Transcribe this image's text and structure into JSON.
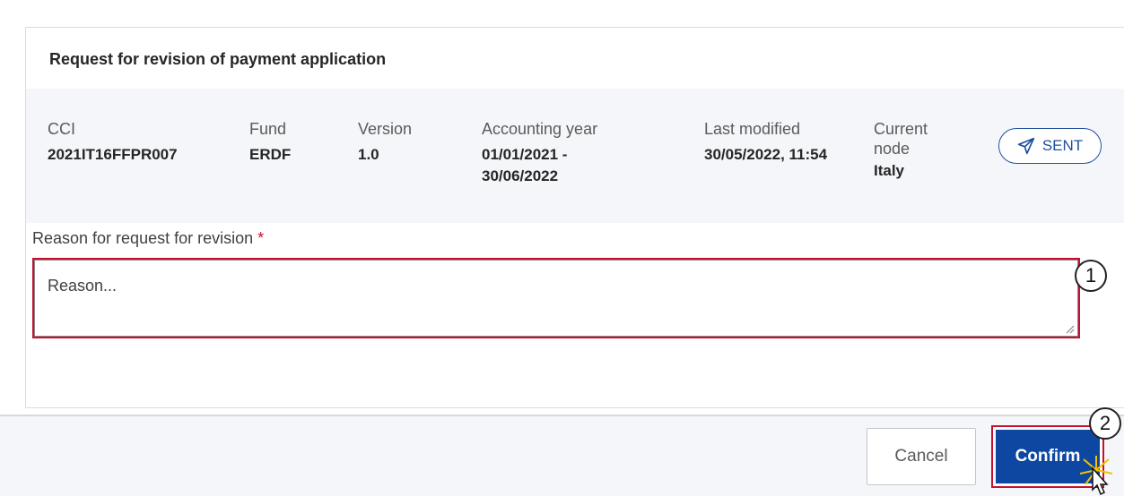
{
  "modal": {
    "title": "Request for revision of payment application"
  },
  "info": {
    "cci": {
      "label": "CCI",
      "value": "2021IT16FFPR007"
    },
    "fund": {
      "label": "Fund",
      "value": "ERDF"
    },
    "version": {
      "label": "Version",
      "value": "1.0"
    },
    "accounting_year": {
      "label": "Accounting year",
      "value": "01/01/2021 - 30/06/2022"
    },
    "last_modified": {
      "label": "Last modified",
      "value": "30/05/2022, 11:54"
    },
    "current_node": {
      "label": "Current node",
      "value": "Italy"
    },
    "status": {
      "label": "SENT",
      "icon": "paper-plane-icon"
    }
  },
  "reason": {
    "label": "Reason for request for revision",
    "required_mark": "*",
    "placeholder": "Reason...",
    "value": ""
  },
  "footer": {
    "cancel_label": "Cancel",
    "confirm_label": "Confirm"
  },
  "annotations": {
    "step1": "1",
    "step2": "2"
  },
  "colors": {
    "primary": "#0e47a1",
    "highlight": "#c8102e",
    "panel_bg": "#f4f6f9"
  }
}
